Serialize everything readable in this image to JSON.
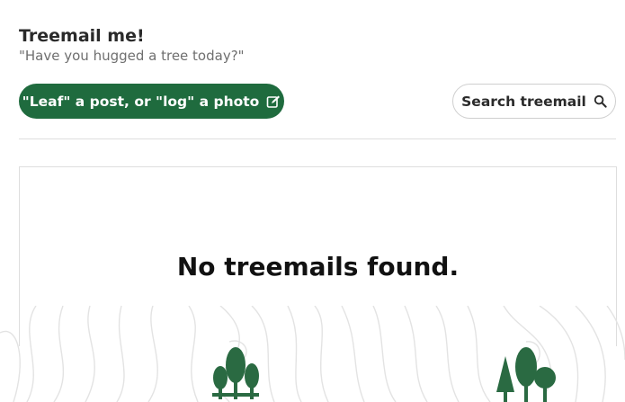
{
  "header": {
    "title": "Treemail me!",
    "subtitle": "\"Have you hugged a tree today?\""
  },
  "actions": {
    "post_label": "\"Leaf\" a post, or \"log\" a photo",
    "post_icon": "edit-icon",
    "search_label": "Search treemail",
    "search_icon": "search-icon"
  },
  "feed": {
    "empty_message": "No treemails found."
  },
  "colors": {
    "brand_green": "#1f6b3e",
    "tree_green": "#2a6a42",
    "contour_gray": "#e3e3e3"
  }
}
